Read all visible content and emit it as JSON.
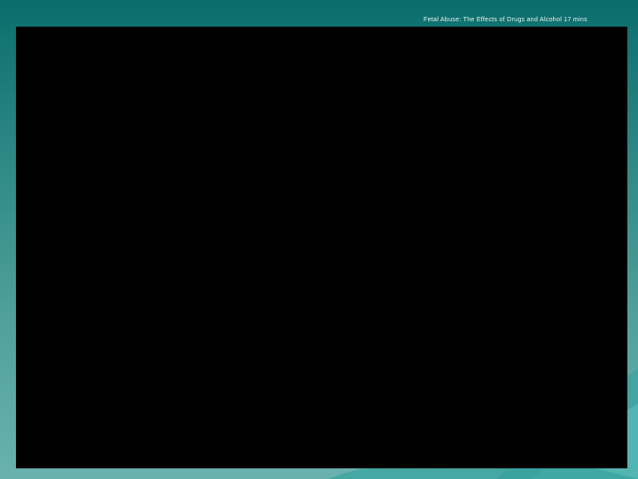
{
  "slide": {
    "title": "Fetal Abuse: The Effects of Drugs and Alcohol 17 mins"
  },
  "colors": {
    "background_top": "#0b6e6c",
    "background_bottom": "#69b2ae",
    "video_frame": "#000000",
    "title_text": "#e8f4f3"
  }
}
